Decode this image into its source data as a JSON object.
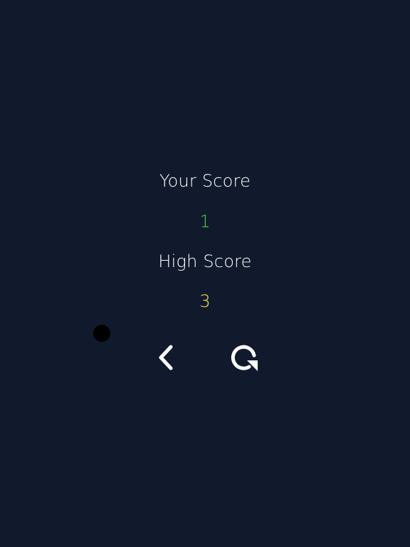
{
  "game_over": {
    "your_score_label": "Your Score",
    "your_score_value": "1",
    "high_score_label": "High Score",
    "high_score_value": "3"
  },
  "colors": {
    "background": "#101a2c",
    "label_text": "#ffffff",
    "your_score_value": "#3ddc3d",
    "high_score_value": "#f2e63a",
    "ball": "#000000",
    "icon": "#ffffff"
  },
  "icons": {
    "back": "chevron-left-icon",
    "restart": "restart-icon"
  }
}
